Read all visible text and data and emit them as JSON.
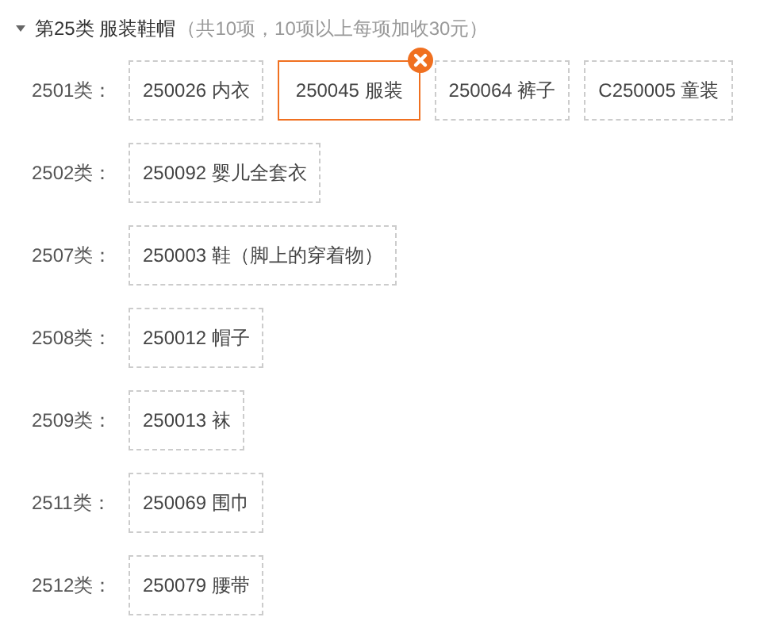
{
  "group": {
    "expanded": true,
    "title": "第25类 服装鞋帽",
    "note": "（共10项，10项以上每项加收30元）"
  },
  "rows": [
    {
      "label": "2501类：",
      "items": [
        {
          "text": "250026 内衣",
          "selected": false
        },
        {
          "text": "250045 服装",
          "selected": true
        },
        {
          "text": "250064 裤子",
          "selected": false
        },
        {
          "text": "C250005 童装",
          "selected": false
        }
      ]
    },
    {
      "label": "2502类：",
      "items": [
        {
          "text": "250092 婴儿全套衣",
          "selected": false
        }
      ]
    },
    {
      "label": "2507类：",
      "items": [
        {
          "text": "250003 鞋（脚上的穿着物）",
          "selected": false
        }
      ]
    },
    {
      "label": "2508类：",
      "items": [
        {
          "text": "250012 帽子",
          "selected": false
        }
      ]
    },
    {
      "label": "2509类：",
      "items": [
        {
          "text": "250013 袜",
          "selected": false
        }
      ]
    },
    {
      "label": "2511类：",
      "items": [
        {
          "text": "250069 围巾",
          "selected": false
        }
      ]
    },
    {
      "label": "2512类：",
      "items": [
        {
          "text": "250079 腰带",
          "selected": false
        }
      ]
    }
  ]
}
